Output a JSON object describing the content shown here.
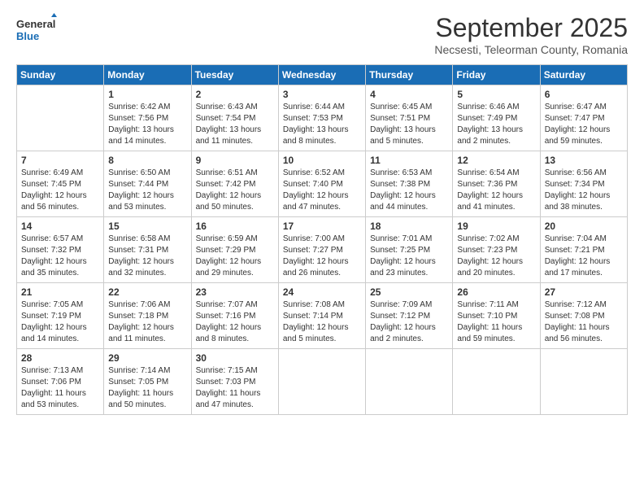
{
  "logo": {
    "text_general": "General",
    "text_blue": "Blue"
  },
  "title": "September 2025",
  "location": "Necsesti, Teleorman County, Romania",
  "weekdays": [
    "Sunday",
    "Monday",
    "Tuesday",
    "Wednesday",
    "Thursday",
    "Friday",
    "Saturday"
  ],
  "weeks": [
    [
      {
        "day": "",
        "sunrise": "",
        "sunset": "",
        "daylight": ""
      },
      {
        "day": "1",
        "sunrise": "Sunrise: 6:42 AM",
        "sunset": "Sunset: 7:56 PM",
        "daylight": "Daylight: 13 hours and 14 minutes."
      },
      {
        "day": "2",
        "sunrise": "Sunrise: 6:43 AM",
        "sunset": "Sunset: 7:54 PM",
        "daylight": "Daylight: 13 hours and 11 minutes."
      },
      {
        "day": "3",
        "sunrise": "Sunrise: 6:44 AM",
        "sunset": "Sunset: 7:53 PM",
        "daylight": "Daylight: 13 hours and 8 minutes."
      },
      {
        "day": "4",
        "sunrise": "Sunrise: 6:45 AM",
        "sunset": "Sunset: 7:51 PM",
        "daylight": "Daylight: 13 hours and 5 minutes."
      },
      {
        "day": "5",
        "sunrise": "Sunrise: 6:46 AM",
        "sunset": "Sunset: 7:49 PM",
        "daylight": "Daylight: 13 hours and 2 minutes."
      },
      {
        "day": "6",
        "sunrise": "Sunrise: 6:47 AM",
        "sunset": "Sunset: 7:47 PM",
        "daylight": "Daylight: 12 hours and 59 minutes."
      }
    ],
    [
      {
        "day": "7",
        "sunrise": "Sunrise: 6:49 AM",
        "sunset": "Sunset: 7:45 PM",
        "daylight": "Daylight: 12 hours and 56 minutes."
      },
      {
        "day": "8",
        "sunrise": "Sunrise: 6:50 AM",
        "sunset": "Sunset: 7:44 PM",
        "daylight": "Daylight: 12 hours and 53 minutes."
      },
      {
        "day": "9",
        "sunrise": "Sunrise: 6:51 AM",
        "sunset": "Sunset: 7:42 PM",
        "daylight": "Daylight: 12 hours and 50 minutes."
      },
      {
        "day": "10",
        "sunrise": "Sunrise: 6:52 AM",
        "sunset": "Sunset: 7:40 PM",
        "daylight": "Daylight: 12 hours and 47 minutes."
      },
      {
        "day": "11",
        "sunrise": "Sunrise: 6:53 AM",
        "sunset": "Sunset: 7:38 PM",
        "daylight": "Daylight: 12 hours and 44 minutes."
      },
      {
        "day": "12",
        "sunrise": "Sunrise: 6:54 AM",
        "sunset": "Sunset: 7:36 PM",
        "daylight": "Daylight: 12 hours and 41 minutes."
      },
      {
        "day": "13",
        "sunrise": "Sunrise: 6:56 AM",
        "sunset": "Sunset: 7:34 PM",
        "daylight": "Daylight: 12 hours and 38 minutes."
      }
    ],
    [
      {
        "day": "14",
        "sunrise": "Sunrise: 6:57 AM",
        "sunset": "Sunset: 7:32 PM",
        "daylight": "Daylight: 12 hours and 35 minutes."
      },
      {
        "day": "15",
        "sunrise": "Sunrise: 6:58 AM",
        "sunset": "Sunset: 7:31 PM",
        "daylight": "Daylight: 12 hours and 32 minutes."
      },
      {
        "day": "16",
        "sunrise": "Sunrise: 6:59 AM",
        "sunset": "Sunset: 7:29 PM",
        "daylight": "Daylight: 12 hours and 29 minutes."
      },
      {
        "day": "17",
        "sunrise": "Sunrise: 7:00 AM",
        "sunset": "Sunset: 7:27 PM",
        "daylight": "Daylight: 12 hours and 26 minutes."
      },
      {
        "day": "18",
        "sunrise": "Sunrise: 7:01 AM",
        "sunset": "Sunset: 7:25 PM",
        "daylight": "Daylight: 12 hours and 23 minutes."
      },
      {
        "day": "19",
        "sunrise": "Sunrise: 7:02 AM",
        "sunset": "Sunset: 7:23 PM",
        "daylight": "Daylight: 12 hours and 20 minutes."
      },
      {
        "day": "20",
        "sunrise": "Sunrise: 7:04 AM",
        "sunset": "Sunset: 7:21 PM",
        "daylight": "Daylight: 12 hours and 17 minutes."
      }
    ],
    [
      {
        "day": "21",
        "sunrise": "Sunrise: 7:05 AM",
        "sunset": "Sunset: 7:19 PM",
        "daylight": "Daylight: 12 hours and 14 minutes."
      },
      {
        "day": "22",
        "sunrise": "Sunrise: 7:06 AM",
        "sunset": "Sunset: 7:18 PM",
        "daylight": "Daylight: 12 hours and 11 minutes."
      },
      {
        "day": "23",
        "sunrise": "Sunrise: 7:07 AM",
        "sunset": "Sunset: 7:16 PM",
        "daylight": "Daylight: 12 hours and 8 minutes."
      },
      {
        "day": "24",
        "sunrise": "Sunrise: 7:08 AM",
        "sunset": "Sunset: 7:14 PM",
        "daylight": "Daylight: 12 hours and 5 minutes."
      },
      {
        "day": "25",
        "sunrise": "Sunrise: 7:09 AM",
        "sunset": "Sunset: 7:12 PM",
        "daylight": "Daylight: 12 hours and 2 minutes."
      },
      {
        "day": "26",
        "sunrise": "Sunrise: 7:11 AM",
        "sunset": "Sunset: 7:10 PM",
        "daylight": "Daylight: 11 hours and 59 minutes."
      },
      {
        "day": "27",
        "sunrise": "Sunrise: 7:12 AM",
        "sunset": "Sunset: 7:08 PM",
        "daylight": "Daylight: 11 hours and 56 minutes."
      }
    ],
    [
      {
        "day": "28",
        "sunrise": "Sunrise: 7:13 AM",
        "sunset": "Sunset: 7:06 PM",
        "daylight": "Daylight: 11 hours and 53 minutes."
      },
      {
        "day": "29",
        "sunrise": "Sunrise: 7:14 AM",
        "sunset": "Sunset: 7:05 PM",
        "daylight": "Daylight: 11 hours and 50 minutes."
      },
      {
        "day": "30",
        "sunrise": "Sunrise: 7:15 AM",
        "sunset": "Sunset: 7:03 PM",
        "daylight": "Daylight: 11 hours and 47 minutes."
      },
      {
        "day": "",
        "sunrise": "",
        "sunset": "",
        "daylight": ""
      },
      {
        "day": "",
        "sunrise": "",
        "sunset": "",
        "daylight": ""
      },
      {
        "day": "",
        "sunrise": "",
        "sunset": "",
        "daylight": ""
      },
      {
        "day": "",
        "sunrise": "",
        "sunset": "",
        "daylight": ""
      }
    ]
  ]
}
